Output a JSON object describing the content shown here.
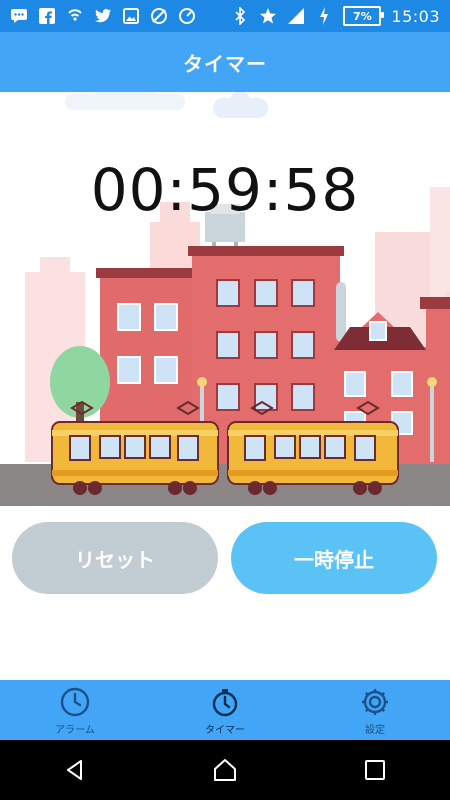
{
  "statusbar": {
    "battery": "7%",
    "time": "15:03"
  },
  "appbar": {
    "title": "タイマー"
  },
  "timer": {
    "display": "00:59:58"
  },
  "buttons": {
    "reset": "リセット",
    "pause": "一時停止"
  },
  "bottomnav": {
    "items": [
      {
        "label": "アラーム",
        "icon": "clock-icon"
      },
      {
        "label": "タイマー",
        "icon": "stopwatch-icon",
        "active": true
      },
      {
        "label": "設定",
        "icon": "gear-icon"
      }
    ]
  },
  "colors": {
    "statusbar": "#1e88e5",
    "appbar": "#42a5f5",
    "reset_button": "#c1ccd3",
    "pause_button": "#5bc2f5"
  }
}
